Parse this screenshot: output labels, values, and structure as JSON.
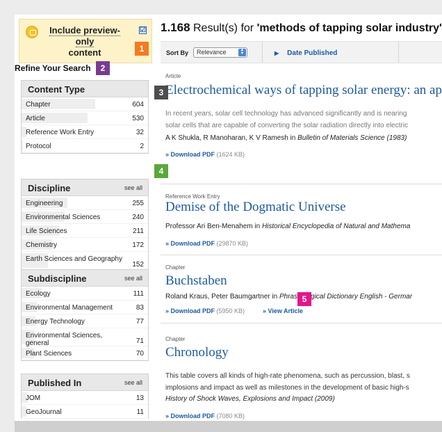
{
  "preview": {
    "label_line1": "Include preview-only",
    "label_line2": "content",
    "checked": "☑"
  },
  "badges": [
    "1",
    "2",
    "3",
    "4",
    "5"
  ],
  "refine_title": "Refine Your Search",
  "facets": {
    "content_type": {
      "title": "Content Type",
      "items": [
        {
          "label": "Chapter",
          "count": "604",
          "frac": 0.58
        },
        {
          "label": "Article",
          "count": "530",
          "frac": 0.52
        },
        {
          "label": "Reference Work Entry",
          "count": "32",
          "frac": 0.04
        },
        {
          "label": "Protocol",
          "count": "2",
          "frac": 0.01
        }
      ]
    },
    "discipline": {
      "title": "Discipline",
      "see_all": "see all",
      "items": [
        {
          "label": "Engineering",
          "count": "255",
          "frac": 0.36
        },
        {
          "label": "Environmental Sciences",
          "count": "240",
          "frac": 0.34
        },
        {
          "label": "Life Sciences",
          "count": "211",
          "frac": 0.3
        },
        {
          "label": "Chemistry",
          "count": "172",
          "frac": 0.24
        },
        {
          "label": "Earth Sciences and Geography",
          "count": "152",
          "frac": 0.21
        }
      ]
    },
    "subdiscipline": {
      "title": "Subdiscipline",
      "see_all": "see all",
      "items": [
        {
          "label": "Ecology",
          "count": "111",
          "frac": 0.16
        },
        {
          "label": "Environmental Management",
          "count": "83",
          "frac": 0.12
        },
        {
          "label": "Energy Technology",
          "count": "77",
          "frac": 0.11
        },
        {
          "label": "Environmental Sciences, general",
          "count": "71",
          "frac": 0.1
        },
        {
          "label": "Plant Sciences",
          "count": "70",
          "frac": 0.1
        }
      ]
    },
    "published_in": {
      "title": "Published In",
      "see_all": "see all",
      "items": [
        {
          "label": "JOM",
          "count": "13",
          "frac": 0.05
        },
        {
          "label": "GeoJournal",
          "count": "11",
          "frac": 0.04
        }
      ]
    }
  },
  "results_header": {
    "count": "1.168",
    "text": " Result(s) for ",
    "query": "'methods of tapping solar industry'"
  },
  "sort": {
    "label": "Sort By",
    "selected": "Relevance",
    "date_published": "Date Published"
  },
  "results": [
    {
      "type": "Article",
      "title": "Electrochemical ways of tapping solar energy: an ap",
      "snippet1": "In recent years, solar cell technology has advanced significantly and is nearing",
      "snippet2": "solar cells that are capable of converting the solar radiation directly into electric",
      "authors": "A K Shukla, R Manoharan, K V Ramesh in ",
      "source": "Bulletin of Materials Science (1983)",
      "download": "» Download PDF",
      "size": " (1624 KB)"
    },
    {
      "type": "Reference Work Entry",
      "title": "Demise of the Dogmatic Universe",
      "authors": "Professor Ari Ben-Menahem in ",
      "source": "Historical Encyclopedia of Natural and Mathema",
      "download": "» Download PDF",
      "size": " (29870 KB)"
    },
    {
      "type": "Chapter",
      "title": "Buchstaben",
      "authors": "Roland Kraus, Peter Baumgartner in ",
      "source": "Phraseological Dictionary English - Germar",
      "download": "» Download PDF",
      "size": " (5950 KB)",
      "view": "» View Article"
    },
    {
      "type": "Chapter",
      "title": "Chronology",
      "snippet1": "This table covers all kinds of high-rate phenomena, such as percussion, blast, s",
      "snippet2": "implosions and impact as well as milestones in the development of basic high-s",
      "source": "History of Shock Waves, Explosions and Impact (2009)",
      "download": "» Download PDF",
      "size": " (7080 KB)"
    }
  ],
  "colors": {
    "link": "#1d5a9e",
    "badge_orange": "#f47a20",
    "badge_purple": "#7a3b8f",
    "badge_gray": "#4d4d4d",
    "badge_green": "#5aa83a",
    "badge_pink": "#e6148c",
    "preview_bg": "#fdf2c8"
  }
}
